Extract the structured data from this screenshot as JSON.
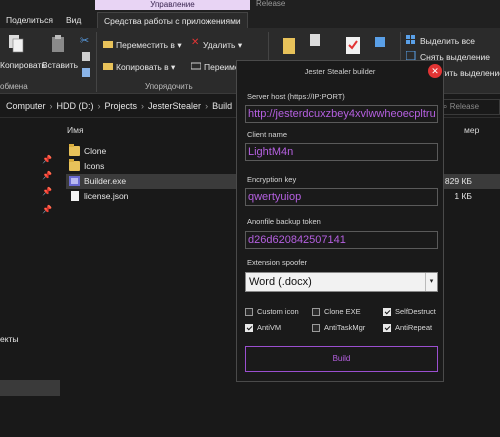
{
  "explorer": {
    "ribbon_tabs": {
      "share": "Поделиться",
      "view": "Вид",
      "app_tools": "Средства работы с приложениями",
      "manage": "Управление",
      "release": "Release"
    },
    "ribbon": {
      "copy": "Копировать",
      "paste": "Вставить",
      "move_to": "Переместить в",
      "copy_to": "Копировать в",
      "delete": "Удалить",
      "rename": "Переиме",
      "select_all": "Выделить все",
      "clear_selection": "Снять выделение",
      "invert_selection": "Обратить выделение",
      "group_clipboard": "обмена",
      "group_organize": "Упорядочить"
    },
    "breadcrumbs": [
      "Computer",
      "HDD (D:)",
      "Projects",
      "JesterStealer",
      "Build"
    ],
    "search_placeholder": "Release",
    "nav_partial_label": "екты",
    "columns": {
      "name": "Имя",
      "size": "мер"
    },
    "files": [
      {
        "name": "Clone",
        "type": "folder",
        "size": ""
      },
      {
        "name": "Icons",
        "type": "folder",
        "size": ""
      },
      {
        "name": "Builder.exe",
        "type": "exe",
        "size": "829 КБ"
      },
      {
        "name": "license.json",
        "type": "json",
        "size": "1 КБ"
      }
    ]
  },
  "builder": {
    "title": "Jester Stealer builder",
    "close_glyph": "✕",
    "fields": {
      "server_host_label": "Server host (https://IP:PORT)",
      "server_host_value": "http://jesterdcuxzbey4xvlwwheoecpltru",
      "client_name_label": "Client name",
      "client_name_value": "LightM4n",
      "encryption_key_label": "Encryption key",
      "encryption_key_value": "qwertyuiop",
      "anonfile_token_label": "Anonfile backup token",
      "anonfile_token_value": "d26d620842507141",
      "extension_spoofer_label": "Extension spoofer",
      "extension_spoofer_value": "Word (.docx)"
    },
    "options": {
      "custom_icon": {
        "label": "Custom icon",
        "checked": false
      },
      "clone_exe": {
        "label": "Clone EXE",
        "checked": false
      },
      "self_destruct": {
        "label": "SelfDestruct",
        "checked": true
      },
      "anti_vm": {
        "label": "AntiVM",
        "checked": true
      },
      "anti_task_mgr": {
        "label": "AntiTaskMgr",
        "checked": false
      },
      "anti_repeat": {
        "label": "AntiRepeat",
        "checked": true
      }
    },
    "build_label": "Build",
    "accent_color": "#b560e0"
  }
}
